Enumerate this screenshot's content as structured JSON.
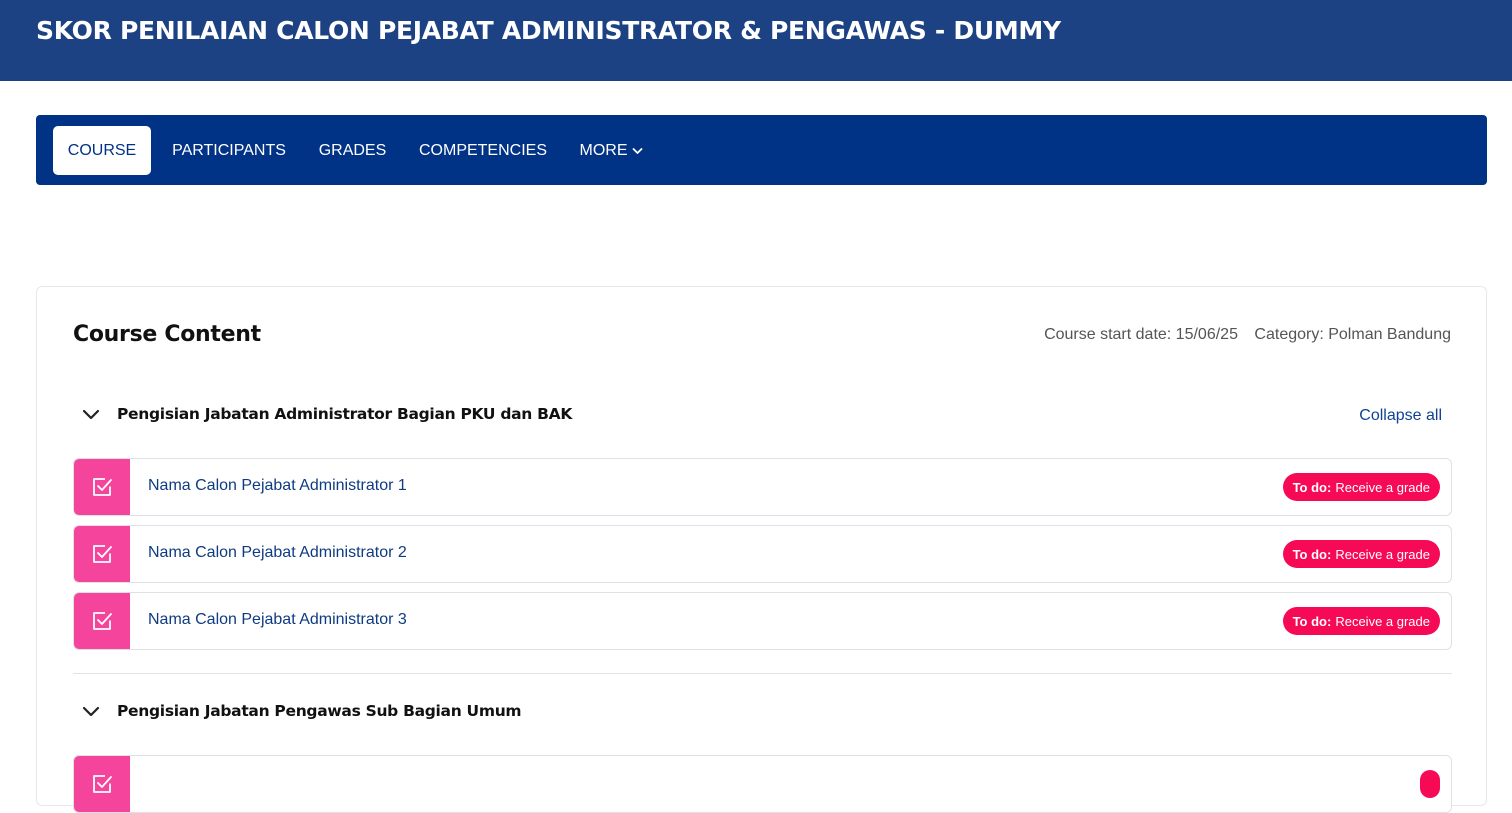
{
  "header": {
    "title": "SKOR PENILAIAN CALON PEJABAT ADMINISTRATOR & PENGAWAS - DUMMY"
  },
  "nav": {
    "tabs": [
      {
        "label": "COURSE",
        "active": true
      },
      {
        "label": "PARTICIPANTS"
      },
      {
        "label": "GRADES"
      },
      {
        "label": "COMPETENCIES"
      },
      {
        "label": "MORE",
        "icon": "chevron-down-icon"
      }
    ]
  },
  "content": {
    "title": "Course Content",
    "start_date": "Course start date: 15/06/25",
    "category": "Category: Polman Bandung",
    "collapse_all": "Collapse all",
    "sections": [
      {
        "title": "Pengisian Jabatan Administrator Bagian PKU dan BAK",
        "expanded": true,
        "activities": [
          {
            "name": "Nama Calon Pejabat Administrator 1",
            "todo_label": "To do:",
            "todo_text": "Receive a grade",
            "icon": "checkbox-assignment-icon"
          },
          {
            "name": "Nama Calon Pejabat Administrator 2",
            "todo_label": "To do:",
            "todo_text": "Receive a grade",
            "icon": "checkbox-assignment-icon"
          },
          {
            "name": "Nama Calon Pejabat Administrator 3",
            "todo_label": "To do:",
            "todo_text": "Receive a grade",
            "icon": "checkbox-assignment-icon"
          }
        ]
      },
      {
        "title": "Pengisian Jabatan Pengawas Sub Bagian Umum",
        "expanded": true,
        "activities": []
      }
    ]
  },
  "colors": {
    "header_bg": "#1d4283",
    "nav_bg": "#003286",
    "activity_icon_bg": "#f5449b",
    "todo_badge_bg": "#f70a55",
    "link": "#0f3b83"
  }
}
